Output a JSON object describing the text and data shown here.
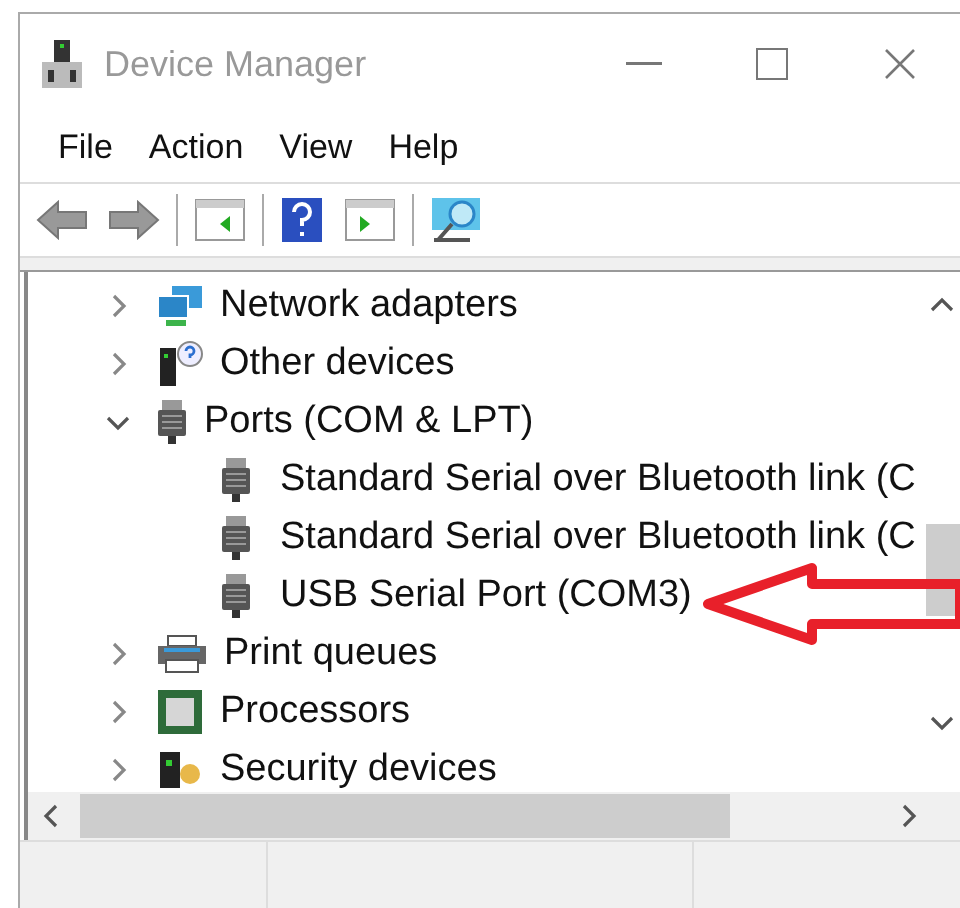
{
  "window": {
    "title": "Device Manager"
  },
  "menu": [
    "File",
    "Action",
    "View",
    "Help"
  ],
  "tree": [
    {
      "label": "Network adapters",
      "kind": "network",
      "expanded": false
    },
    {
      "label": "Other devices",
      "kind": "unknown",
      "expanded": false
    },
    {
      "label": "Ports (COM & LPT)",
      "kind": "port",
      "expanded": true,
      "children": [
        {
          "label": "Standard Serial over Bluetooth link (C",
          "kind": "port"
        },
        {
          "label": "Standard Serial over Bluetooth link (C",
          "kind": "port"
        },
        {
          "label": "USB Serial Port (COM3)",
          "kind": "port"
        }
      ]
    },
    {
      "label": "Print queues",
      "kind": "printer",
      "expanded": false
    },
    {
      "label": "Processors",
      "kind": "chip",
      "expanded": false
    },
    {
      "label": "Security devices",
      "kind": "security",
      "expanded": false
    }
  ]
}
